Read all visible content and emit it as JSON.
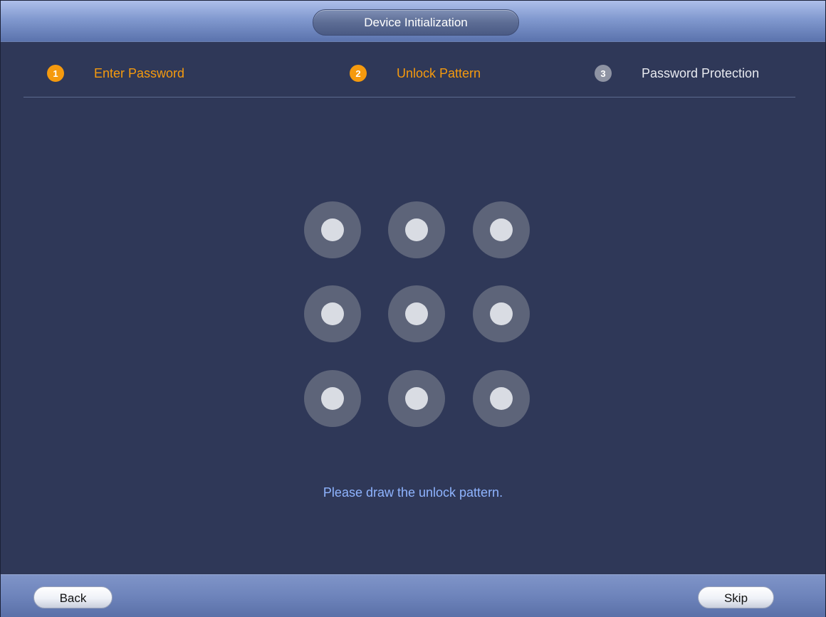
{
  "window": {
    "title": "Device Initialization"
  },
  "steps": [
    {
      "number": "1",
      "label": "Enter Password",
      "state": "active"
    },
    {
      "number": "2",
      "label": "Unlock Pattern",
      "state": "active"
    },
    {
      "number": "3",
      "label": "Password Protection",
      "state": "inactive"
    }
  ],
  "pattern": {
    "hint": "Please draw the unlock pattern.",
    "dots": 9
  },
  "buttons": {
    "back": "Back",
    "skip": "Skip"
  },
  "colors": {
    "accent": "#f59a0e",
    "inactive_step": "#8e93a3",
    "hint_text": "#8fb4ff",
    "background": "#2f3858"
  }
}
